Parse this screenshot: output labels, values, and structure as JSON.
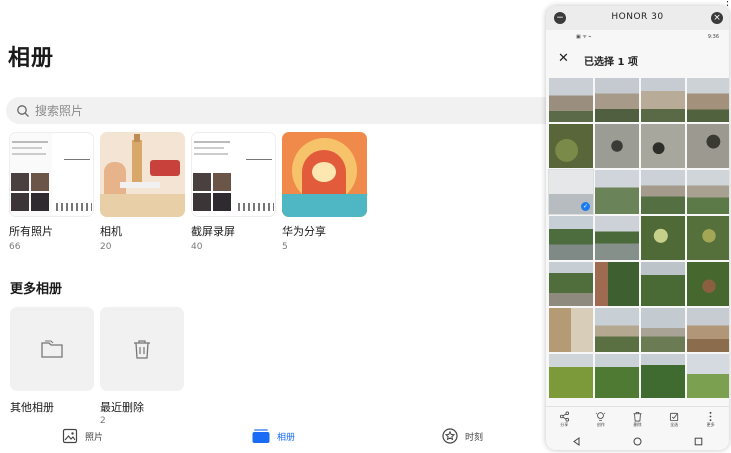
{
  "page": {
    "title": "相册"
  },
  "search": {
    "placeholder": "搜索照片"
  },
  "albums": [
    {
      "name": "所有照片",
      "count": "66"
    },
    {
      "name": "相机",
      "count": "20"
    },
    {
      "name": "截屏录屏",
      "count": "40"
    },
    {
      "name": "华为分享",
      "count": "5"
    }
  ],
  "more": {
    "title": "更多相册",
    "items": [
      {
        "name": "其他相册",
        "count": ""
      },
      {
        "name": "最近删除",
        "count": "2"
      }
    ]
  },
  "tabs": [
    {
      "label": "照片",
      "icon": "image-icon",
      "active": false
    },
    {
      "label": "相册",
      "icon": "album-icon",
      "active": true
    },
    {
      "label": "时刻",
      "icon": "star-icon",
      "active": false
    }
  ],
  "phone": {
    "window_title": "HONOR 30",
    "status_right": "9:36",
    "selection_title": "已选择 1 项",
    "actions": [
      {
        "label": "分享",
        "icon": "share-icon"
      },
      {
        "label": "创作",
        "icon": "lightbulb-icon"
      },
      {
        "label": "删除",
        "icon": "trash-icon"
      },
      {
        "label": "全选",
        "icon": "select-all-icon"
      },
      {
        "label": "更多",
        "icon": "more-icon"
      }
    ]
  },
  "colors": {
    "accent": "#1a6cf5",
    "check": "#1a7cf0",
    "search_bg": "#f1f1f1"
  }
}
